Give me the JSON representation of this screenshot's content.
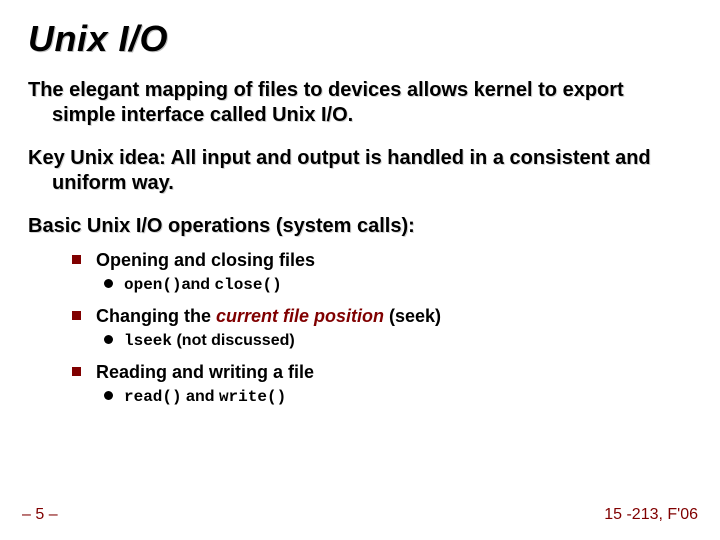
{
  "title": "Unix I/O",
  "paragraphs": {
    "p1": "The elegant mapping of files to devices allows kernel to export simple interface called Unix I/O.",
    "p2": "Key Unix idea: All input and output is handled in a consistent and uniform way.",
    "p3": "Basic Unix I/O operations (system calls):"
  },
  "ops": {
    "item1": {
      "label": "Opening and closing files",
      "sub": {
        "code1": "open()",
        "mid": "and ",
        "code2": "close()"
      }
    },
    "item2": {
      "pre": "Changing the ",
      "em": "current file position",
      "post": " (seek)",
      "sub": {
        "code1": "lseek",
        "rest": " (not discussed)"
      }
    },
    "item3": {
      "label": "Reading and writing a file",
      "sub": {
        "code1": "read()",
        "mid": " and ",
        "code2": "write()"
      }
    }
  },
  "footer": {
    "left": "– 5 –",
    "right": "15 -213, F'06"
  }
}
